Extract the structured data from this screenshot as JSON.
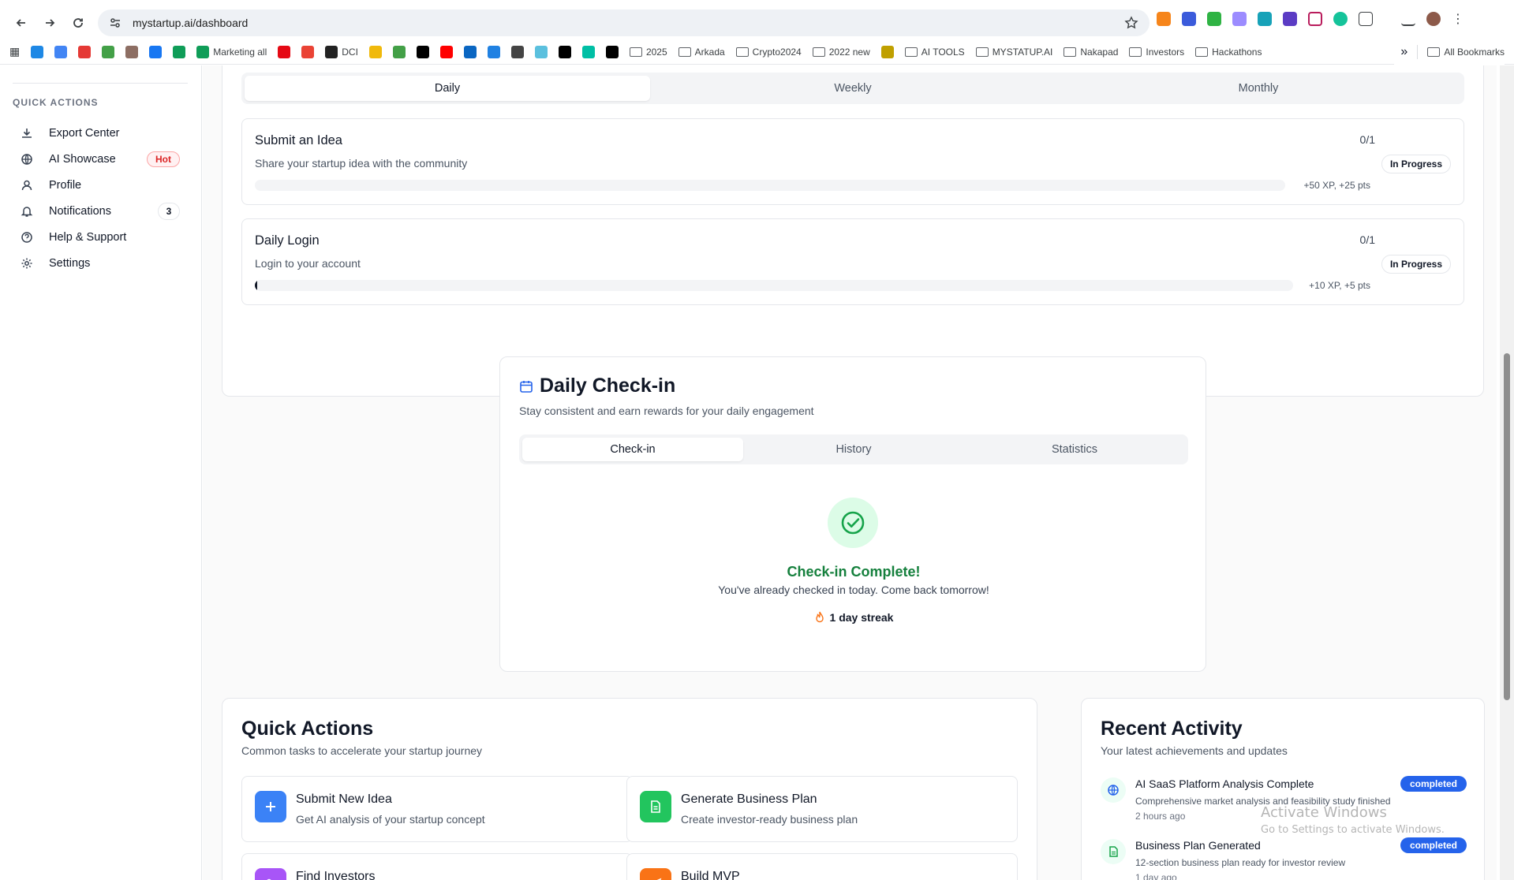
{
  "browser": {
    "url": "mystartup.ai/dashboard",
    "bookmarks": [
      {
        "label": "",
        "icon": "edge-icon",
        "color": "#1e88e5"
      },
      {
        "label": "",
        "icon": "google-icon",
        "color": "#4285f4"
      },
      {
        "label": "",
        "icon": "d-icon",
        "color": "#e53935"
      },
      {
        "label": "",
        "icon": "frog-icon",
        "color": "#43a047"
      },
      {
        "label": "",
        "icon": "lion-icon",
        "color": "#8d6e63"
      },
      {
        "label": "",
        "icon": "facebook-icon",
        "color": "#1877f2"
      },
      {
        "label": "",
        "icon": "sheets-icon",
        "color": "#0f9d58"
      },
      {
        "label": "Marketing all",
        "icon": "sheets-icon",
        "color": "#0f9d58"
      },
      {
        "label": "",
        "icon": "netflix-icon",
        "color": "#e50914"
      },
      {
        "label": "",
        "icon": "gmail-icon",
        "color": "#ea4335"
      },
      {
        "label": "DCI",
        "icon": "dci-icon",
        "color": "#222222"
      },
      {
        "label": "",
        "icon": "binance-icon",
        "color": "#f0b90b"
      },
      {
        "label": "",
        "icon": "frog-icon",
        "color": "#43a047"
      },
      {
        "label": "",
        "icon": "x-icon",
        "color": "#000000"
      },
      {
        "label": "",
        "icon": "youtube-icon",
        "color": "#ff0000"
      },
      {
        "label": "",
        "icon": "linkedin-icon",
        "color": "#0a66c2"
      },
      {
        "label": "",
        "icon": "opensea-icon",
        "color": "#2081e2"
      },
      {
        "label": "",
        "icon": "globe-icon",
        "color": "#444444"
      },
      {
        "label": "",
        "icon": "chart-icon",
        "color": "#5bc0de"
      },
      {
        "label": "",
        "icon": "p-icon",
        "color": "#000000"
      },
      {
        "label": "",
        "icon": "wind-icon",
        "color": "#00bfa5"
      },
      {
        "label": "",
        "icon": "grid-icon",
        "color": "#000000"
      },
      {
        "label": "2025",
        "icon": "folder-icon",
        "color": "#5f6368"
      },
      {
        "label": "Arkada",
        "icon": "folder-icon",
        "color": "#5f6368"
      },
      {
        "label": "Crypto2024",
        "icon": "folder-icon",
        "color": "#5f6368"
      },
      {
        "label": "2022 new",
        "icon": "folder-icon",
        "color": "#5f6368"
      },
      {
        "label": "",
        "icon": "bird-icon",
        "color": "#c0a000"
      },
      {
        "label": "AI TOOLS",
        "icon": "folder-icon",
        "color": "#5f6368"
      },
      {
        "label": "MYSTATUP.AI",
        "icon": "folder-icon",
        "color": "#5f6368"
      },
      {
        "label": "Nakapad",
        "icon": "folder-icon",
        "color": "#5f6368"
      },
      {
        "label": "Investors",
        "icon": "folder-icon",
        "color": "#5f6368"
      },
      {
        "label": "Hackathons",
        "icon": "folder-icon",
        "color": "#5f6368"
      }
    ],
    "all_bookmarks": "All Bookmarks",
    "more": "»"
  },
  "sidebar": {
    "section_title": "QUICK ACTIONS",
    "items": [
      {
        "label": "Export Center",
        "icon": "download-icon"
      },
      {
        "label": "AI Showcase",
        "icon": "globe-icon",
        "badge": "Hot"
      },
      {
        "label": "Profile",
        "icon": "user-icon"
      },
      {
        "label": "Notifications",
        "icon": "bell-icon",
        "count": "3"
      },
      {
        "label": "Help & Support",
        "icon": "help-icon"
      },
      {
        "label": "Settings",
        "icon": "gear-icon"
      }
    ]
  },
  "challenges": {
    "tabs": [
      "Daily",
      "Weekly",
      "Monthly"
    ],
    "active_tab": "Daily",
    "tasks": [
      {
        "title": "Submit an Idea",
        "description": "Share your startup idea with the community",
        "count": "0/1",
        "status": "In Progress",
        "reward": "+50 XP, +25 pts",
        "progress": 0
      },
      {
        "title": "Daily Login",
        "description": "Login to your account",
        "count": "0/1",
        "status": "In Progress",
        "reward": "+10 XP, +5 pts",
        "progress": 0.002
      }
    ]
  },
  "checkin": {
    "title": "Daily Check-in",
    "subtitle": "Stay consistent and earn rewards for your daily engagement",
    "tabs": [
      "Check-in",
      "History",
      "Statistics"
    ],
    "active_tab": "Check-in",
    "complete_title": "Check-in Complete!",
    "complete_message": "You've already checked in today. Come back tomorrow!",
    "streak": "1 day streak"
  },
  "quick_actions": {
    "title": "Quick Actions",
    "subtitle": "Common tasks to accelerate your startup journey",
    "items": [
      {
        "title": "Submit New Idea",
        "description": "Get AI analysis of your startup concept",
        "icon": "plus-icon",
        "color": "#3b82f6"
      },
      {
        "title": "Generate Business Plan",
        "description": "Create investor-ready business plan",
        "icon": "document-icon",
        "color": "#22c55e"
      },
      {
        "title": "Find Investors",
        "description": "",
        "icon": "users-icon",
        "color": "#a855f7"
      },
      {
        "title": "Build MVP",
        "description": "",
        "icon": "rocket-icon",
        "color": "#f97316"
      }
    ]
  },
  "recent_activity": {
    "title": "Recent Activity",
    "subtitle": "Your latest achievements and updates",
    "items": [
      {
        "title": "AI SaaS Platform Analysis Complete",
        "description": "Comprehensive market analysis and feasibility study finished",
        "time": "2 hours ago",
        "status": "completed",
        "icon": "globe-icon"
      },
      {
        "title": "Business Plan Generated",
        "description": "12-section business plan ready for investor review",
        "time": "1 day ago",
        "status": "completed",
        "icon": "document-icon"
      }
    ]
  },
  "watermark": {
    "line1": "Activate Windows",
    "line2": "Go to Settings to activate Windows."
  }
}
